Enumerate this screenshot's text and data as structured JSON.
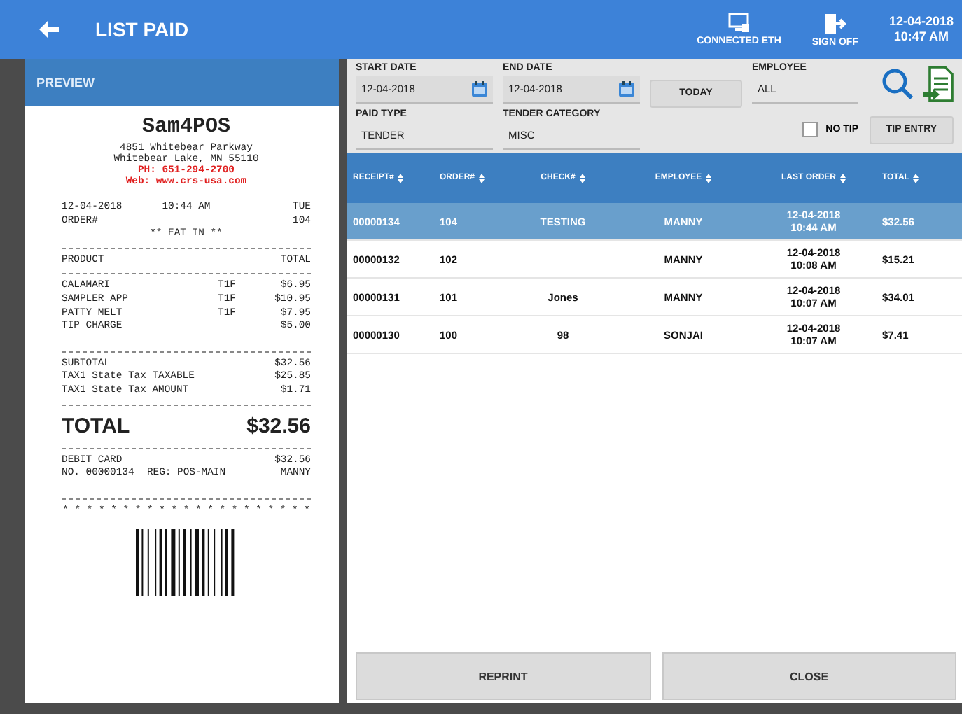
{
  "header": {
    "title": "LIST PAID",
    "status": [
      {
        "kind": "network",
        "label": "CONNECTED ETH"
      },
      {
        "kind": "signoff",
        "label": "SIGN OFF"
      }
    ],
    "date": "12-04-2018",
    "time": "10:47 AM"
  },
  "preview": {
    "title": "PREVIEW",
    "store": "Sam4POS",
    "address": [
      "4851 Whitebear Parkway",
      "Whitebear Lake, MN 55110"
    ],
    "contact": [
      "PH: 651-294-2700",
      "Web: www.crs-usa.com"
    ],
    "lines": [
      {
        "kind": "three",
        "cells": [
          "12-04-2018",
          "10:44 AM",
          "TUE"
        ]
      },
      {
        "kind": "split",
        "cells": [
          "ORDER#",
          "104"
        ]
      },
      {
        "kind": "center",
        "cells": [
          "** EAT IN **"
        ]
      },
      {
        "kind": "rule"
      },
      {
        "kind": "split",
        "cells": [
          "PRODUCT",
          "TOTAL"
        ]
      },
      {
        "kind": "rule"
      },
      {
        "kind": "item",
        "cells": [
          "CALAMARI",
          "T1F",
          "$6.95"
        ]
      },
      {
        "kind": "item",
        "cells": [
          "SAMPLER APP",
          "T1F",
          "$10.95"
        ]
      },
      {
        "kind": "item",
        "cells": [
          "PATTY MELT",
          "T1F",
          "$7.95"
        ]
      },
      {
        "kind": "item",
        "cells": [
          "TIP CHARGE",
          "",
          "$5.00"
        ]
      },
      {
        "kind": "gap"
      },
      {
        "kind": "rule"
      },
      {
        "kind": "split",
        "cells": [
          "SUBTOTAL",
          "$32.56"
        ]
      },
      {
        "kind": "split",
        "cells": [
          "TAX1 State Tax TAXABLE",
          "$25.85"
        ]
      },
      {
        "kind": "split",
        "cells": [
          "TAX1 State Tax AMOUNT",
          "$1.71"
        ]
      },
      {
        "kind": "rule"
      },
      {
        "kind": "total",
        "cells": [
          "TOTAL",
          "$32.56"
        ]
      },
      {
        "kind": "rule"
      },
      {
        "kind": "split",
        "cells": [
          "DEBIT CARD",
          "$32.56"
        ]
      },
      {
        "kind": "three",
        "cells": [
          "NO. 00000134",
          "REG: POS-MAIN",
          "MANNY"
        ]
      },
      {
        "kind": "gap"
      },
      {
        "kind": "rule"
      },
      {
        "kind": "center",
        "cells": [
          "* * * * * * * * * * * * * * * * * * * * *"
        ]
      }
    ]
  },
  "filters": {
    "start_date": {
      "label": "START DATE",
      "value": "12-04-2018"
    },
    "end_date": {
      "label": "END DATE",
      "value": "12-04-2018"
    },
    "today_button": "TODAY",
    "employee": {
      "label": "EMPLOYEE",
      "value": "ALL"
    },
    "paid_type": {
      "label": "PAID TYPE",
      "value": "TENDER"
    },
    "tender_category": {
      "label": "TENDER CATEGORY",
      "value": "MISC"
    },
    "no_tip": {
      "label": "NO TIP",
      "checked": false
    },
    "tip_entry_button": "TIP ENTRY"
  },
  "table": {
    "columns": [
      "RECEIPT#",
      "ORDER#",
      "CHECK#",
      "EMPLOYEE",
      "LAST ORDER",
      "TOTAL"
    ],
    "rows": [
      {
        "selected": true,
        "cells": [
          "00000134",
          "104",
          "TESTING",
          "MANNY",
          "12-04-2018\n10:44 AM",
          "$32.56"
        ]
      },
      {
        "selected": false,
        "cells": [
          "00000132",
          "102",
          "",
          "MANNY",
          "12-04-2018\n10:08 AM",
          "$15.21"
        ]
      },
      {
        "selected": false,
        "cells": [
          "00000131",
          "101",
          "Jones",
          "MANNY",
          "12-04-2018\n10:07 AM",
          "$34.01"
        ]
      },
      {
        "selected": false,
        "cells": [
          "00000130",
          "100",
          "98",
          "SONJAI",
          "12-04-2018\n10:07 AM",
          "$7.41"
        ]
      }
    ]
  },
  "buttons": [
    "REPRINT",
    "CLOSE"
  ]
}
